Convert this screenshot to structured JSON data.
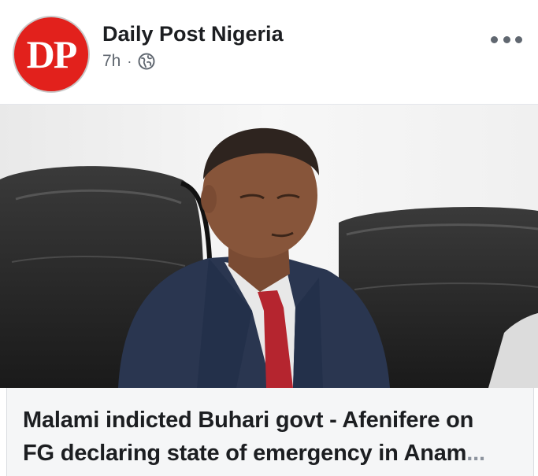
{
  "post": {
    "page_name": "Daily Post Nigeria",
    "avatar_text": "DP",
    "timestamp": "7h",
    "separator": "·",
    "privacy_icon": "globe-icon",
    "more_icon": "more-options-icon"
  },
  "link_preview": {
    "headline_line1": "Malami indicted Buhari govt - Afenifere on",
    "headline_line2": "FG declaring state of emergency in Anam",
    "ellipsis": "..."
  },
  "colors": {
    "brand_red": "#e2211c",
    "text_primary": "#1c1e21",
    "text_secondary": "#606770"
  }
}
